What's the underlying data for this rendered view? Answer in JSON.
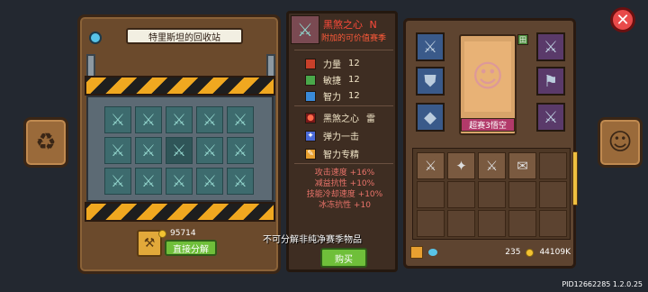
{
  "recycle_station": {
    "title": "特里斯坦的回收站",
    "coins": "95714",
    "decompose_button": "直接分解"
  },
  "tooltip": "不可分解非纯净赛季物品",
  "item": {
    "name": "黑煞之心",
    "level_badge": "N",
    "subtitle": "附加的可价值赛季",
    "stats": [
      {
        "label": "力量",
        "value": "12",
        "color": "#c8402a"
      },
      {
        "label": "敏捷",
        "value": "12",
        "color": "#4aa84a"
      },
      {
        "label": "智力",
        "value": "12",
        "color": "#3a8ad8"
      }
    ],
    "skills": [
      {
        "label": "黑煞之心",
        "suffix": "雷",
        "icon": "dark-orb-icon"
      },
      {
        "label": "弹力一击",
        "icon": "bouncy-strike-icon"
      },
      {
        "label": "智力专精",
        "icon": "intellect-mastery-icon"
      }
    ],
    "effects": [
      "攻击速度 +16%",
      "减益抗性 +10%",
      "技能冷却速度 +10%",
      "冰冻抗性 +10"
    ],
    "buy_button": "购买"
  },
  "character": {
    "label": "超赛3悟空",
    "badge": "田"
  },
  "currency": {
    "gems": "235",
    "gold": "44109K"
  },
  "footer": {
    "pid": "PID12662285 1.2.0.25"
  },
  "icons": {
    "recycle": "recycle-icon",
    "hero": "hero-face-icon",
    "close": "close-icon"
  }
}
